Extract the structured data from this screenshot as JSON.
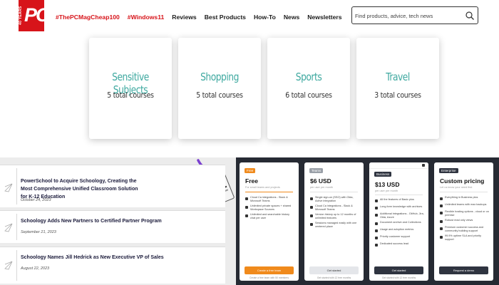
{
  "header": {
    "logo_years": "40 YEARS",
    "logo_text": "PC",
    "nav": [
      {
        "label": "#ThePCMagCheap100",
        "style": "red"
      },
      {
        "label": "#Windows11",
        "style": "red"
      },
      {
        "label": "Reviews",
        "style": "dark"
      },
      {
        "label": "Best Products",
        "style": "dark"
      },
      {
        "label": "How-To",
        "style": "dark"
      },
      {
        "label": "News",
        "style": "dark"
      },
      {
        "label": "Newsletters",
        "style": "dark"
      }
    ],
    "search_placeholder": "Find products, advice, tech news",
    "accent": "#d7141a"
  },
  "courses": [
    {
      "title": "Sensitive Subjects",
      "count": "5 total courses"
    },
    {
      "title": "Shopping",
      "count": "5 total courses"
    },
    {
      "title": "Sports",
      "count": "6 total courses"
    },
    {
      "title": "Travel",
      "count": "3 total courses"
    }
  ],
  "course_color": "#3fa9a0",
  "news": [
    {
      "title": "PowerSchool to Acquire Schoology, Creating the Most Comprehensive Unified Classroom Solution for K-12 Education",
      "date": "October 24, 2023"
    },
    {
      "title": "Schoology Adds New Partners to Certified Partner Program",
      "date": "September 21, 2023"
    },
    {
      "title": "Schoology Names Jill Hedrick as New Executive VP of Sales",
      "date": "August 22, 2023"
    }
  ],
  "pricing": [
    {
      "badge": "Free",
      "badge_color": "#f08a1c",
      "name": "Free",
      "sub": "For small teams and projects",
      "features": [
        "Cloud Ca integrations - Slack & Microsoft Teams",
        "Unlimited private spaces + shared Workspace Sources",
        "Unlimited and searchable history chat per user"
      ],
      "button": "Create a free team",
      "button_bg": "#f08a1c",
      "button_fg": "#ffffff",
      "foot": "Create a free team with 50 members"
    },
    {
      "badge": "Teams",
      "badge_color": "#9aa0a8",
      "name": "$6 USD",
      "sub": "per user per month",
      "features": [
        "Single sign-on (SSO) with Okta, Active integration",
        "Cloud Ca integrations - Slack & Microsoft Teams",
        "Version history up to 12 months of unlimited features",
        "Sessions managed easily with one centered place"
      ],
      "button": "Get started",
      "button_bg": "#e4e6ea",
      "button_fg": "#333333",
      "foot": "Get started with 12 free months"
    },
    {
      "badge": "Business",
      "badge_color": "#2f3440",
      "name": "$13 USD",
      "sub": "per user per month",
      "features": [
        "All the features of Basic plus",
        "Long form knowledge with archives",
        "Additional integrations - GitHub, Jira, Okta, Azure",
        "Document archive and Collections",
        "Usage and adoption metrics",
        "Priority customer support",
        "Dedicated success lead"
      ],
      "button": "Get started",
      "button_bg": "#2f3440",
      "button_fg": "#ffffff",
      "foot": "Get started with 12 free months"
    },
    {
      "badge": "Enterprise",
      "badge_color": "#2f3440",
      "name": "Custom pricing",
      "sub": "Let us know your need first",
      "features": [
        "Everything in Business plus",
        "Unlimited teams with max backups",
        "Flexible hosting options - cloud or on premise",
        "Robust read only views",
        "Premium customer success and community building support",
        "99.9% uptime SLA and priority support"
      ],
      "button": "Request a demo",
      "button_bg": "#2f3440",
      "button_fg": "#ffffff",
      "foot": ""
    }
  ]
}
